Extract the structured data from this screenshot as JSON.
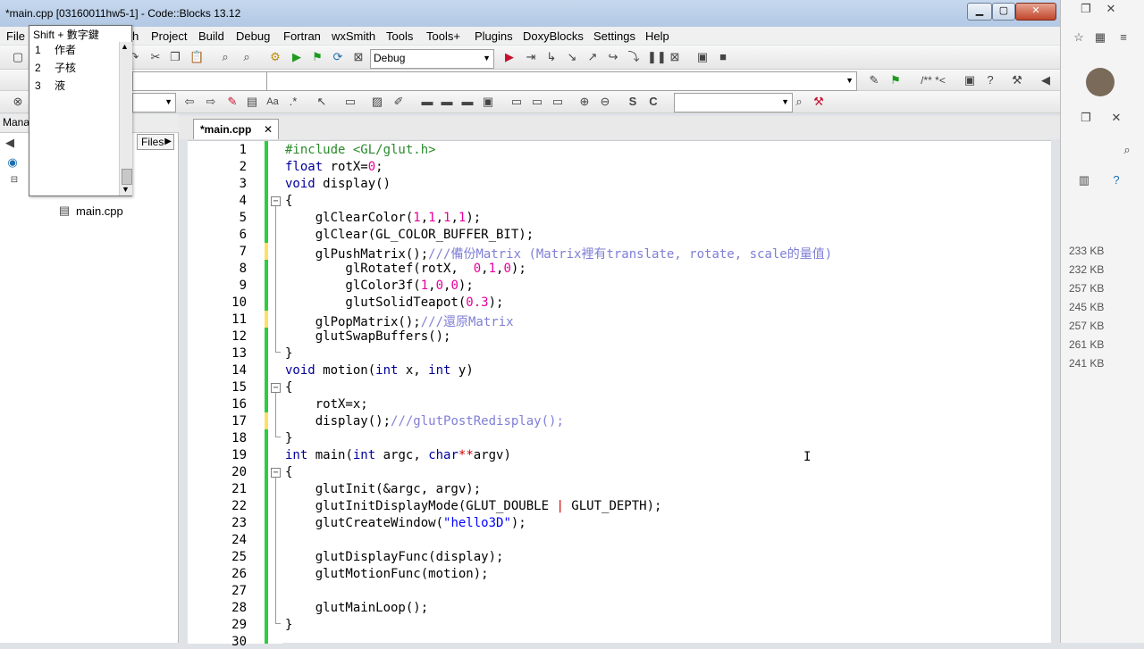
{
  "window": {
    "title": "*main.cpp [03160011hw5-1] - Code::Blocks 13.12",
    "min": "▁",
    "max": "▢",
    "close": "✕"
  },
  "menu": [
    "File",
    "h",
    "Project",
    "Build",
    "Debug",
    "Fortran",
    "wxSmith",
    "Tools",
    "Tools+",
    "Plugins",
    "DoxyBlocks",
    "Settings",
    "Help"
  ],
  "toolbar": {
    "build_target": "Debug"
  },
  "left_panel": {
    "header": "Mana",
    "files_tab": "Files",
    "tree_file": "main.cpp"
  },
  "editor": {
    "tab_label": "*main.cpp",
    "tab_close": "✕"
  },
  "code": [
    "#include <GL/glut.h>",
    "float rotX=0;",
    "void display()",
    "{",
    "    glClearColor(1,1,1,1);",
    "    glClear(GL_COLOR_BUFFER_BIT);",
    "    glPushMatrix();///備份Matrix (Matrix裡有translate, rotate, scale的量值)",
    "        glRotatef(rotX,  0,1,0);",
    "        glColor3f(1,0,0);",
    "        glutSolidTeapot(0.3);",
    "    glPopMatrix();///還原Matrix",
    "    glutSwapBuffers();",
    "}",
    "void motion(int x, int y)",
    "{",
    "    rotX=x;",
    "    display();///glutPostRedisplay();",
    "}",
    "int main(int argc, char**argv)",
    "{",
    "    glutInit(&argc, argv);",
    "    glutInitDisplayMode(GLUT_DOUBLE | GLUT_DEPTH);",
    "    glutCreateWindow(\"hello3D\");",
    "",
    "    glutDisplayFunc(display);",
    "    glutMotionFunc(motion);",
    "",
    "    glutMainLoop();",
    "}",
    ""
  ],
  "line_numbers": [
    "1",
    "2",
    "3",
    "4",
    "5",
    "6",
    "7",
    "8",
    "9",
    "10",
    "11",
    "12",
    "13",
    "14",
    "15",
    "16",
    "17",
    "18",
    "19",
    "20",
    "21",
    "22",
    "23",
    "24",
    "25",
    "26",
    "27",
    "28",
    "29",
    "30"
  ],
  "ime": {
    "header": "Shift + 數字鍵",
    "candidates": [
      {
        "num": "1",
        "text": "作者"
      },
      {
        "num": "2",
        "text": "子核"
      },
      {
        "num": "3",
        "text": "液"
      }
    ]
  },
  "right_panel": {
    "sizes": [
      "233 KB",
      "232 KB",
      "257 KB",
      "245 KB",
      "257 KB",
      "261 KB",
      "241 KB"
    ]
  },
  "colors": {
    "keyword": "#00009a",
    "preprocessor": "#2a8a2a",
    "number": "#e60099",
    "comment": "#7f7fd6",
    "changebar": "#2ecc40"
  }
}
